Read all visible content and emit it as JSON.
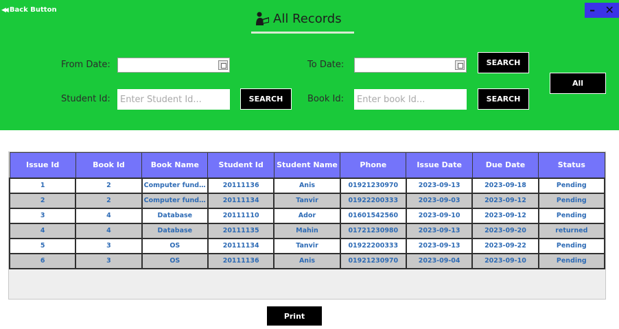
{
  "header": {
    "back_label": "Back Button",
    "back_icon": "double-left-arrow-icon",
    "title": "All Records",
    "title_icon": "reader-icon",
    "minimize_label": "–",
    "close_label": "✕",
    "accent_color": "#1ac93a"
  },
  "filters": {
    "from_date_label": "From Date:",
    "from_date_value": "",
    "to_date_label": "To Date:",
    "to_date_value": "",
    "date_search_label": "SEARCH",
    "student_id_label": "Student Id:",
    "student_id_placeholder": "Enter Student Id...",
    "student_search_label": "SEARCH",
    "book_id_label": "Book Id:",
    "book_id_placeholder": "Enter book Id...",
    "book_search_label": "SEARCH",
    "all_label": "All"
  },
  "table": {
    "header_color": "#7474fa",
    "columns": [
      "Issue Id",
      "Book Id",
      "Book Name",
      "Student Id",
      "Student Name",
      "Phone",
      "Issue Date",
      "Due Date",
      "Status"
    ],
    "rows": [
      [
        "1",
        "2",
        "Computer funda...",
        "20111136",
        "Anis",
        "01921230970",
        "2023-09-13",
        "2023-09-18",
        "Pending"
      ],
      [
        "2",
        "2",
        "Computer funda...",
        "20111134",
        "Tanvir",
        "01922200333",
        "2023-09-03",
        "2023-09-12",
        "Pending"
      ],
      [
        "3",
        "4",
        "Database",
        "20111110",
        "Ador",
        "01601542560",
        "2023-09-10",
        "2023-09-12",
        "Pending"
      ],
      [
        "4",
        "4",
        "Database",
        "20111135",
        "Mahin",
        "01721230980",
        "2023-09-13",
        "2023-09-20",
        "returned"
      ],
      [
        "5",
        "3",
        "OS",
        "20111134",
        "Tanvir",
        "01922200333",
        "2023-09-13",
        "2023-09-22",
        "Pending"
      ],
      [
        "6",
        "3",
        "OS",
        "20111136",
        "Anis",
        "01921230970",
        "2023-09-04",
        "2023-09-10",
        "Pending"
      ]
    ]
  },
  "footer": {
    "print_label": "Print"
  }
}
